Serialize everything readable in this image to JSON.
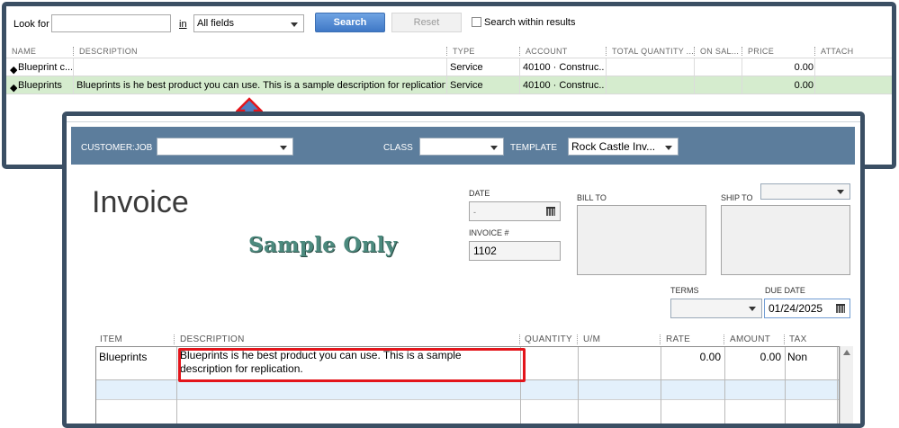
{
  "item_list": {
    "search": {
      "look_for_label": "Look for",
      "look_for_value": "",
      "in_label": "in",
      "field_select": "All fields",
      "search_button": "Search",
      "reset_button": "Reset",
      "within_results_label": "Search within results"
    },
    "columns": [
      "NAME",
      "DESCRIPTION",
      "TYPE",
      "ACCOUNT",
      "TOTAL QUANTITY ...",
      "ON SAL...",
      "PRICE",
      "ATTACH"
    ],
    "rows": [
      {
        "name": "Blueprint c...",
        "description": "",
        "type": "Service",
        "account": "40100 · Construc...",
        "total_quantity": "",
        "on_sales": "",
        "price": "0.00",
        "attach": "",
        "selected": false
      },
      {
        "name": "Blueprints",
        "description": "Blueprints is he best product you can use. This is a sample description for replication.",
        "type": "Service",
        "account": "40100 · Construc...",
        "total_quantity": "",
        "on_sales": "",
        "price": "0.00",
        "attach": "",
        "selected": true
      }
    ]
  },
  "invoice": {
    "header": {
      "customer_job_label": "CUSTOMER:JOB",
      "customer_job_value": "",
      "class_label": "CLASS",
      "class_value": "",
      "template_label": "TEMPLATE",
      "template_value": "Rock Castle Inv..."
    },
    "title": "Invoice",
    "watermark": "Sample Only",
    "date_label": "DATE",
    "date_value": "-",
    "invoice_no_label": "INVOICE #",
    "invoice_no_value": "1102",
    "bill_to_label": "BILL TO",
    "ship_to_label": "SHIP TO",
    "terms_label": "TERMS",
    "terms_value": "",
    "due_date_label": "DUE DATE",
    "due_date_value": "01/24/2025",
    "line_columns": [
      "ITEM",
      "DESCRIPTION",
      "QUANTITY",
      "U/M",
      "RATE",
      "AMOUNT",
      "TAX"
    ],
    "lines": [
      {
        "item": "Blueprints",
        "description_line1": "Blueprints is he best product you can use. This is a sample",
        "description_line2": "description for replication.",
        "quantity": "",
        "um": "",
        "rate": "0.00",
        "amount": "0.00",
        "tax": "Non"
      }
    ]
  },
  "colors": {
    "window_border": "#3b4f64",
    "header_bar": "#5c7d9c",
    "selected_row": "#d5ecce",
    "highlight_row": "#e3f0fb",
    "red_highlight": "#e3151b",
    "search_button": "#3f78c6"
  },
  "annotations": {
    "arrow_icon": "up-arrow-icon",
    "highlight": "description-highlight-box"
  }
}
